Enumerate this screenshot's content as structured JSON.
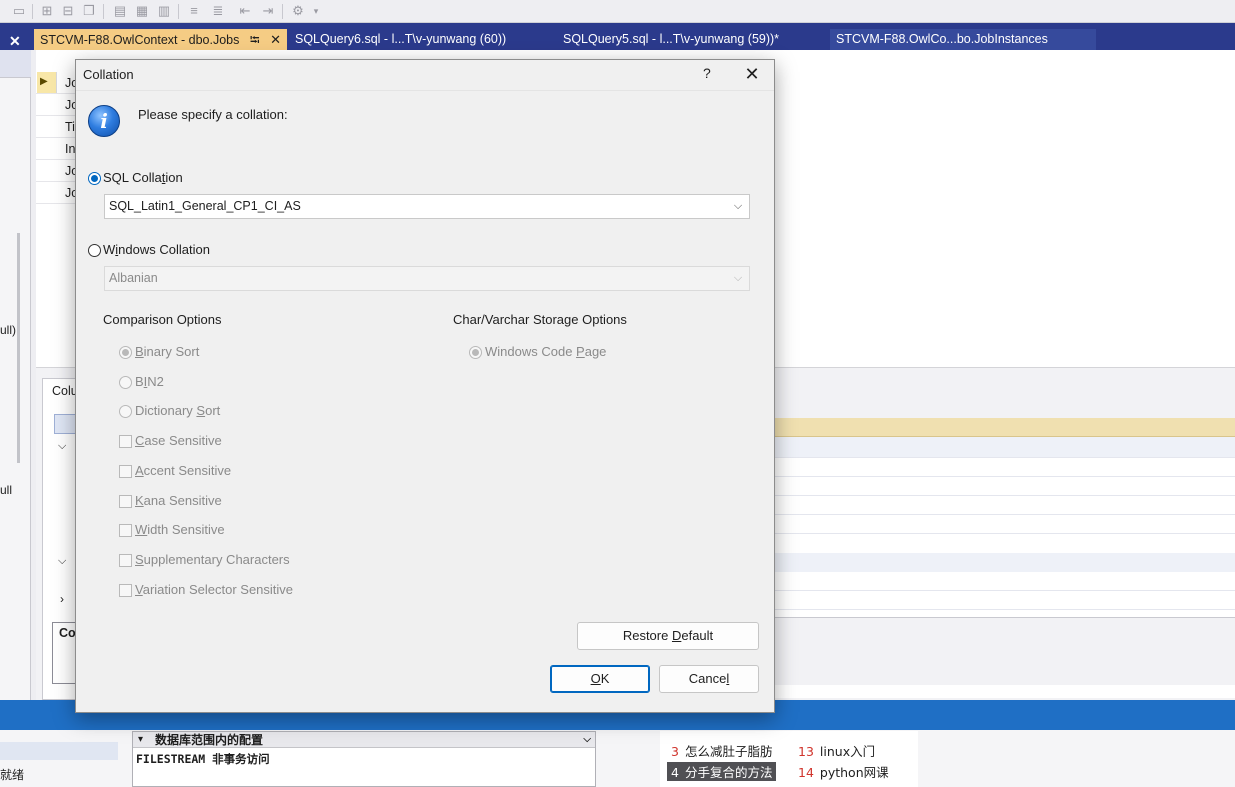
{
  "ide": {
    "tabs": [
      {
        "label": "STCVM-F88.OwlContext - dbo.Jobs",
        "pin": "⭾",
        "close": "✕"
      },
      {
        "label": "SQLQuery6.sql - l...T\\v-yunwang (60))"
      },
      {
        "label": "SQLQuery5.sql - l...T\\v-yunwang (59))*"
      },
      {
        "label": "STCVM-F88.OwlCo...bo.JobInstances"
      }
    ],
    "left_close": "✕",
    "grid_rows": [
      "Jo",
      "Jo",
      "Ti",
      "In",
      "Jo",
      "Jo"
    ],
    "props_label": "Colu",
    "props_section": "Co",
    "left_partial_1": "ull)",
    "left_partial_2": "ull",
    "bottom": {
      "cfg_header": "数据库范围内的配置",
      "cfg_row": "FILESTREAM 非事务访问",
      "status": "就绪",
      "trends": [
        {
          "n": "3",
          "text": "怎么减肚子脂肪"
        },
        {
          "n": "13",
          "text": "linux入门"
        },
        {
          "n": "4",
          "text": "分手复合的方法"
        },
        {
          "n": "14",
          "text": "python网课"
        }
      ]
    }
  },
  "dialog": {
    "title": "Collation",
    "help": "?",
    "close": "✕",
    "info_glyph": "i",
    "prompt": "Please specify a collation:",
    "sql_collation": {
      "pre": "SQL Colla",
      "ul": "t",
      "post": "ion",
      "selected": true,
      "value": "SQL_Latin1_General_CP1_CI_AS"
    },
    "windows_collation": {
      "pre": "W",
      "ul": "i",
      "post": "ndows Collation",
      "selected": false,
      "value": "Albanian"
    },
    "comparison_title": "Comparison Options",
    "storage_title": "Char/Varchar Storage Options",
    "comparison_options": [
      {
        "type": "radio",
        "pre": "",
        "ul": "B",
        "post": "inary Sort",
        "checked": true
      },
      {
        "type": "radio",
        "pre": "B",
        "ul": "I",
        "post": "N2",
        "checked": false
      },
      {
        "type": "radio",
        "pre": "Dictionary ",
        "ul": "S",
        "post": "ort",
        "checked": false
      },
      {
        "type": "check",
        "pre": "",
        "ul": "C",
        "post": "ase Sensitive",
        "checked": false
      },
      {
        "type": "check",
        "pre": "",
        "ul": "A",
        "post": "ccent Sensitive",
        "checked": false
      },
      {
        "type": "check",
        "pre": "",
        "ul": "K",
        "post": "ana Sensitive",
        "checked": false
      },
      {
        "type": "check",
        "pre": "",
        "ul": "W",
        "post": "idth Sensitive",
        "checked": false
      },
      {
        "type": "check",
        "pre": "",
        "ul": "S",
        "post": "upplementary Characters",
        "checked": false
      },
      {
        "type": "check",
        "pre": "",
        "ul": "V",
        "post": "ariation Selector Sensitive",
        "checked": false
      }
    ],
    "storage_option": {
      "pre": "Windows Code ",
      "ul": "P",
      "post": "age",
      "checked": true
    },
    "restore_default": {
      "pre": "Restore ",
      "ul": "D",
      "post": "efault"
    },
    "ok": {
      "pre": "",
      "ul": "O",
      "post": "K"
    },
    "cancel": {
      "pre": "Cance",
      "ul": "l",
      "post": ""
    },
    "arrow": "⌵"
  }
}
